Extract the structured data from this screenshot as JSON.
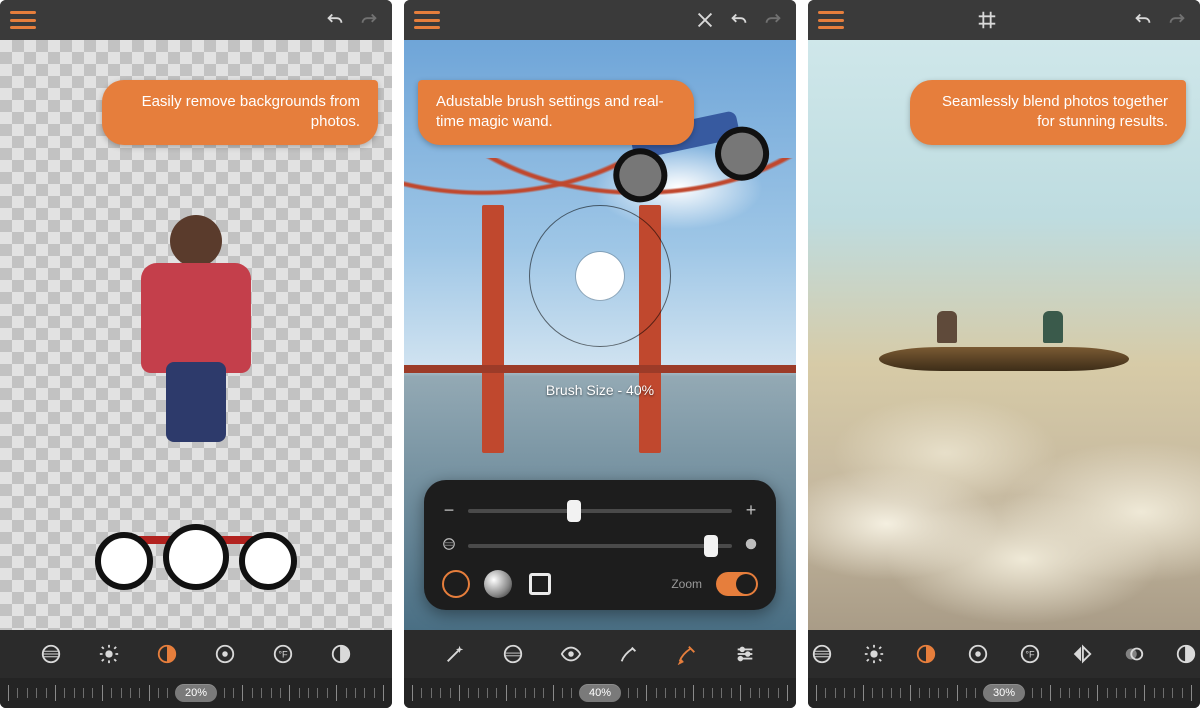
{
  "colors": {
    "accent": "#e67e3c",
    "bar": "#3a3a3a",
    "panel": "#1d1d1d"
  },
  "screens": [
    {
      "callout": "Easily remove backgrounds from photos.",
      "callout_side": "right",
      "ruler_value": "20%",
      "tools": [
        "gradient",
        "brightness",
        "half-contrast",
        "vignette",
        "temperature",
        "invert"
      ],
      "active_tool_index": 2
    },
    {
      "callout": "Adustable brush settings and real-time magic wand.",
      "callout_side": "left",
      "brush_label": "Brush Size - 40%",
      "panel": {
        "slider1_pos": 0.4,
        "slider2_pos": 0.92,
        "zoom_label": "Zoom",
        "zoom_on": true
      },
      "ruler_value": "40%",
      "tools": [
        "magic-wand",
        "erase-gradient",
        "eye-visibility",
        "brush-soft",
        "brush-hard",
        "sliders"
      ],
      "active_tool_index": 4
    },
    {
      "callout": "Seamlessly blend photos together for stunning results.",
      "callout_side": "right",
      "ruler_value": "30%",
      "tools": [
        "gradient",
        "brightness",
        "half-contrast",
        "vignette",
        "temperature",
        "mirror",
        "opacity",
        "invert"
      ],
      "active_tool_index": 2
    }
  ]
}
